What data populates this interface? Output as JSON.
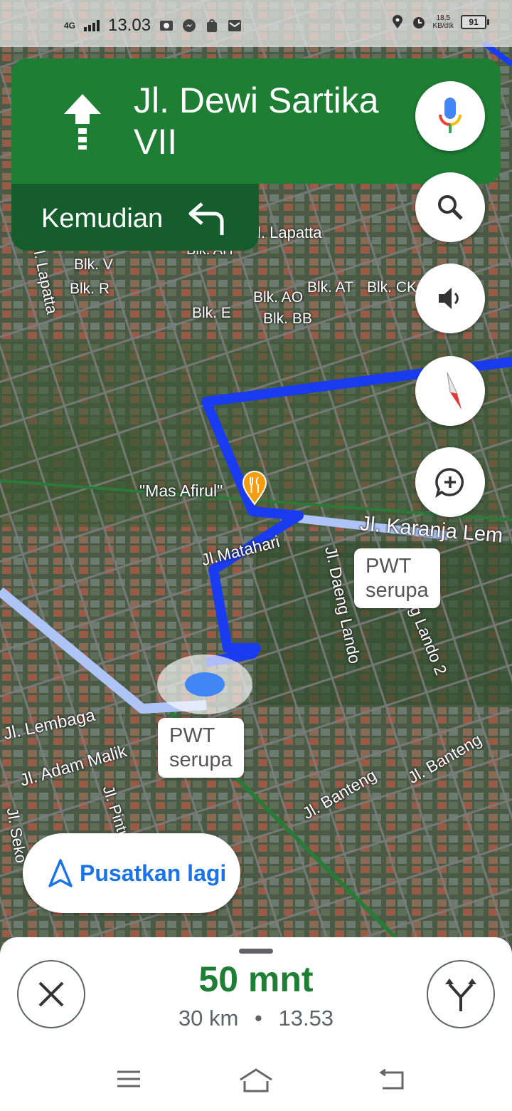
{
  "status_bar": {
    "network": "4G",
    "time": "13.03",
    "speed_value": "18,5",
    "speed_unit": "KB/dtk",
    "battery": "91"
  },
  "navigation": {
    "direction_icon": "straight-arrow-icon",
    "street_line1": "Jl. Dewi Sartika",
    "street_line2": "VII",
    "then_label": "Kemudian",
    "then_icon": "turn-left-arrow-icon"
  },
  "map": {
    "labels": {
      "jl_lapatta_left": "Jl. Lapatta",
      "jl_lapatta_right": "l. Lapatta",
      "blk_ah": "Blk. AH",
      "blk_v": "Blk. V",
      "blk_r": "Blk. R",
      "blk_e": "Blk. E",
      "blk_ao": "Blk. AO",
      "blk_at": "Blk. AT",
      "blk_ck": "Blk. CK",
      "blk_bb": "Blk. BB",
      "mas_afirul": "\"Mas Afirul\"",
      "jl_matahari": "Jl.Matahari",
      "jl_karanja": "Jl. Karanja Lem",
      "jl_daeng_lando": "Jl. Daeng Lando",
      "daeng_lando_2": "ng Lando 2",
      "jl_lembaga": "Jl. Lembaga",
      "jl_adam_malik": "Jl. Adam Malik",
      "jl_pintu": "Jl. Pintu",
      "jl_seko": "Jl. Seko",
      "jl_banteng1": "Jl. Banteng",
      "jl_banteng2": "Jl. Banteng"
    },
    "chips": [
      {
        "line1": "PWT",
        "line2": "serupa"
      },
      {
        "line1": "PWT",
        "line2": "serupa"
      }
    ]
  },
  "recenter": {
    "label": "Pusatkan lagi"
  },
  "trip": {
    "eta": "50 mnt",
    "distance": "30 km",
    "separator": "•",
    "arrival": "13.53"
  },
  "colors": {
    "nav_green": "#1e7e34",
    "nav_green_dark": "#155d2d",
    "route_blue": "#1a3cf0",
    "alt_route": "#a9c0f5",
    "accent_blue": "#1a73e8"
  }
}
